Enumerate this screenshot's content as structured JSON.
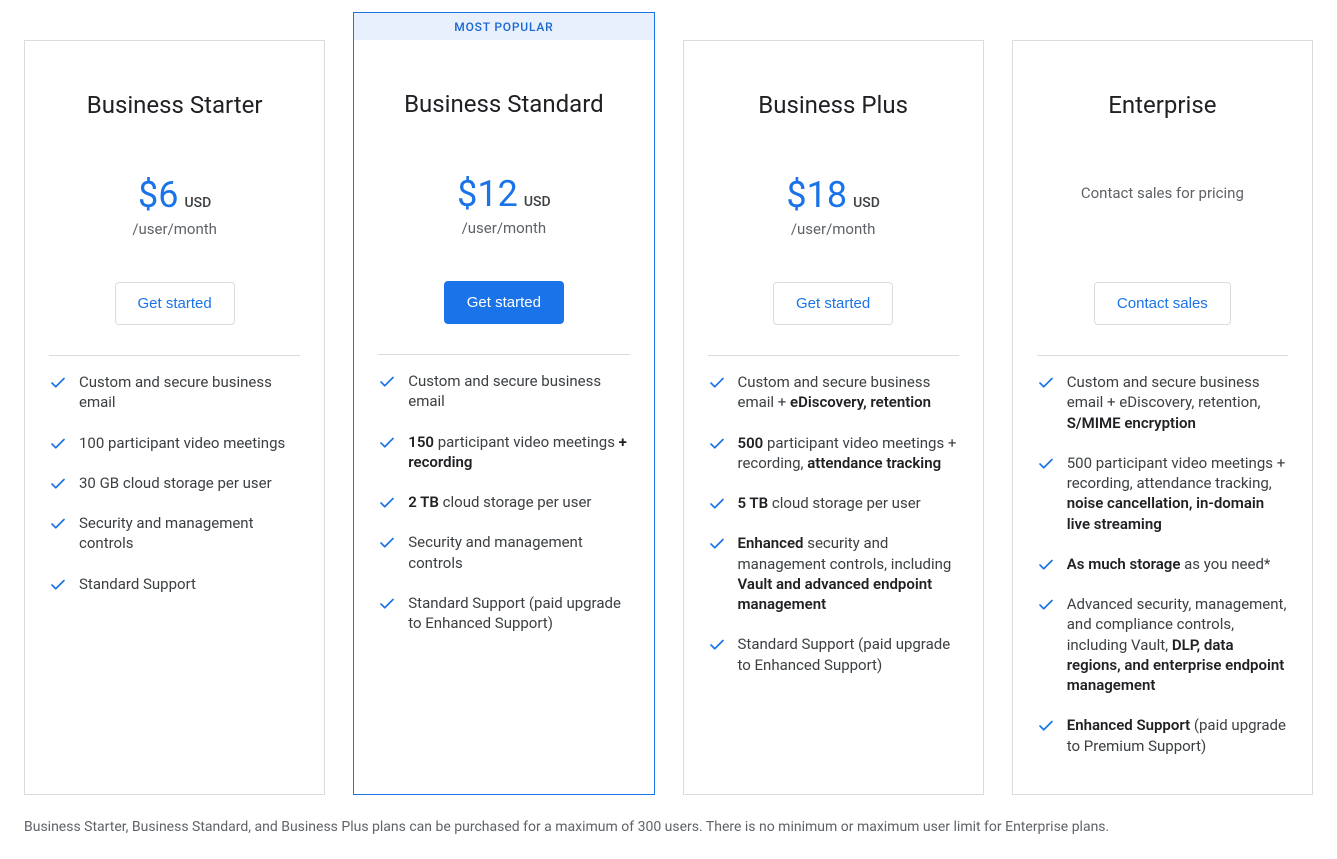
{
  "badge": "MOST POPULAR",
  "plans": [
    {
      "name": "Business Starter",
      "price": "$6",
      "currency": "USD",
      "per": "/user/month",
      "contact": null,
      "cta": "Get started",
      "featured": false,
      "features": [
        {
          "segments": [
            {
              "t": "Custom and secure business email",
              "b": false
            }
          ]
        },
        {
          "segments": [
            {
              "t": "100 participant video meetings",
              "b": false
            }
          ]
        },
        {
          "segments": [
            {
              "t": "30 GB cloud storage per user",
              "b": false
            }
          ]
        },
        {
          "segments": [
            {
              "t": "Security and management controls",
              "b": false
            }
          ]
        },
        {
          "segments": [
            {
              "t": "Standard Support",
              "b": false
            }
          ]
        }
      ]
    },
    {
      "name": "Business Standard",
      "price": "$12",
      "currency": "USD",
      "per": "/user/month",
      "contact": null,
      "cta": "Get started",
      "featured": true,
      "features": [
        {
          "segments": [
            {
              "t": "Custom and secure business email",
              "b": false
            }
          ]
        },
        {
          "segments": [
            {
              "t": "150",
              "b": true
            },
            {
              "t": " participant video meetings ",
              "b": false
            },
            {
              "t": "+ recording",
              "b": true
            }
          ]
        },
        {
          "segments": [
            {
              "t": "2 TB",
              "b": true
            },
            {
              "t": " cloud storage per user",
              "b": false
            }
          ]
        },
        {
          "segments": [
            {
              "t": "Security and management controls",
              "b": false
            }
          ]
        },
        {
          "segments": [
            {
              "t": "Standard Support (paid upgrade to Enhanced Support)",
              "b": false
            }
          ]
        }
      ]
    },
    {
      "name": "Business Plus",
      "price": "$18",
      "currency": "USD",
      "per": "/user/month",
      "contact": null,
      "cta": "Get started",
      "featured": false,
      "features": [
        {
          "segments": [
            {
              "t": "Custom and secure business email + ",
              "b": false
            },
            {
              "t": "eDiscovery, retention",
              "b": true
            }
          ]
        },
        {
          "segments": [
            {
              "t": "500",
              "b": true
            },
            {
              "t": " participant video meetings + recording, ",
              "b": false
            },
            {
              "t": "attendance tracking",
              "b": true
            }
          ]
        },
        {
          "segments": [
            {
              "t": "5 TB",
              "b": true
            },
            {
              "t": " cloud storage per user",
              "b": false
            }
          ]
        },
        {
          "segments": [
            {
              "t": "Enhanced",
              "b": true
            },
            {
              "t": " security and management controls, including ",
              "b": false
            },
            {
              "t": "Vault and advanced endpoint management",
              "b": true
            }
          ]
        },
        {
          "segments": [
            {
              "t": "Standard Support (paid upgrade to Enhanced Support)",
              "b": false
            }
          ]
        }
      ]
    },
    {
      "name": "Enterprise",
      "price": null,
      "currency": null,
      "per": null,
      "contact": "Contact sales for pricing",
      "cta": "Contact sales",
      "featured": false,
      "features": [
        {
          "segments": [
            {
              "t": "Custom and secure business email + eDiscovery, retention, ",
              "b": false
            },
            {
              "t": "S/MIME encryption",
              "b": true
            }
          ]
        },
        {
          "segments": [
            {
              "t": "500 participant video meetings + recording, attendance tracking, ",
              "b": false
            },
            {
              "t": "noise cancellation, in-domain live streaming",
              "b": true
            }
          ]
        },
        {
          "segments": [
            {
              "t": "As much storage",
              "b": true
            },
            {
              "t": " as you need*",
              "b": false
            }
          ]
        },
        {
          "segments": [
            {
              "t": "Advanced security, management, and compliance controls, including Vault, ",
              "b": false
            },
            {
              "t": "DLP, data regions, and enterprise endpoint management",
              "b": true
            }
          ]
        },
        {
          "segments": [
            {
              "t": "Enhanced Support",
              "b": true
            },
            {
              "t": " (paid upgrade to Premium Support)",
              "b": false
            }
          ]
        }
      ]
    }
  ],
  "footnote": "Business Starter, Business Standard, and Business Plus plans can be purchased for a maximum of 300 users. There is no minimum or maximum user limit for Enterprise plans."
}
